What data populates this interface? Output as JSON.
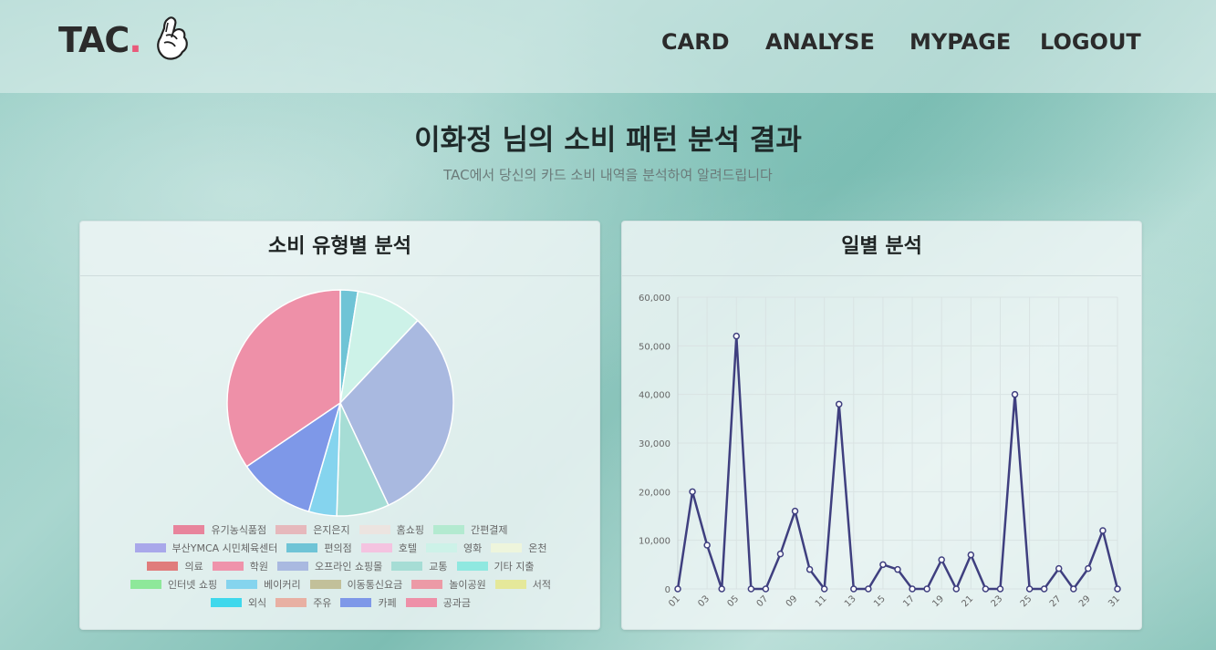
{
  "header": {
    "logo_text": "TAC",
    "logo_dot": ".",
    "nav": [
      "CARD",
      "ANALYSE",
      "MYPAGE",
      "LOGOUT"
    ]
  },
  "page": {
    "title": "이화정 님의 소비 패턴 분석 결과",
    "subtitle": "TAC에서 당신의 카드 소비 내역을 분석하여 알려드립니다"
  },
  "pie_card": {
    "title": "소비 유형별 분석"
  },
  "line_card": {
    "title": "일별 분석"
  },
  "chart_data": [
    {
      "type": "pie",
      "labels": [
        "유기농식품점",
        "은지은지",
        "홈쇼핑",
        "간편결제",
        "부산YMCA 시민체육센터",
        "편의점",
        "호텔",
        "영화",
        "온천",
        "의료",
        "학원",
        "오프라인 쇼핑몰",
        "교통",
        "기타 지출",
        "인터넷 쇼핑",
        "베이커리",
        "이동통신요금",
        "놀이공원",
        "서적",
        "외식",
        "주유",
        "카페",
        "공과금"
      ],
      "colors": [
        "#e8849c",
        "#e6b8bc",
        "#ece4e0",
        "#b3ead0",
        "#a9a8ea",
        "#6fc4d6",
        "#f4c3e0",
        "#cdf2e8",
        "#eef5dc",
        "#e07c7c",
        "#ef93ab",
        "#a9b9e0",
        "#a6ddd5",
        "#8fe8e0",
        "#8ee89a",
        "#85d4ee",
        "#c2c09a",
        "#ec9aa6",
        "#e5e89a",
        "#3fd8ec",
        "#e8b0a3",
        "#7e98e8",
        "#ee90a8"
      ],
      "values": [
        0,
        0,
        0,
        0,
        0,
        2.5,
        0,
        9.5,
        0,
        0,
        0,
        31,
        7.5,
        0,
        0,
        4,
        0,
        0,
        0,
        0,
        0,
        11,
        34.5
      ]
    },
    {
      "type": "line",
      "x": [
        "01",
        "02",
        "03",
        "04",
        "05",
        "06",
        "07",
        "08",
        "09",
        "10",
        "11",
        "12",
        "13",
        "14",
        "15",
        "16",
        "17",
        "18",
        "19",
        "20",
        "21",
        "22",
        "23",
        "24",
        "25",
        "26",
        "27",
        "28",
        "29",
        "30",
        "31"
      ],
      "x_tick_labels": [
        "01",
        "03",
        "05",
        "07",
        "09",
        "11",
        "13",
        "15",
        "17",
        "19",
        "21",
        "23",
        "25",
        "27",
        "29",
        "31"
      ],
      "y": [
        0,
        20000,
        9000,
        0,
        52000,
        0,
        0,
        7200,
        16000,
        4000,
        0,
        38000,
        0,
        0,
        5000,
        4000,
        0,
        0,
        6000,
        0,
        7000,
        0,
        0,
        40000,
        0,
        0,
        4200,
        0,
        4200,
        12000,
        0
      ],
      "ylim": [
        0,
        60000
      ],
      "y_ticks": [
        "0",
        "10,000",
        "20,000",
        "30,000",
        "40,000",
        "50,000",
        "60,000"
      ],
      "line_color": "#3f3f7f",
      "grid": true
    }
  ]
}
